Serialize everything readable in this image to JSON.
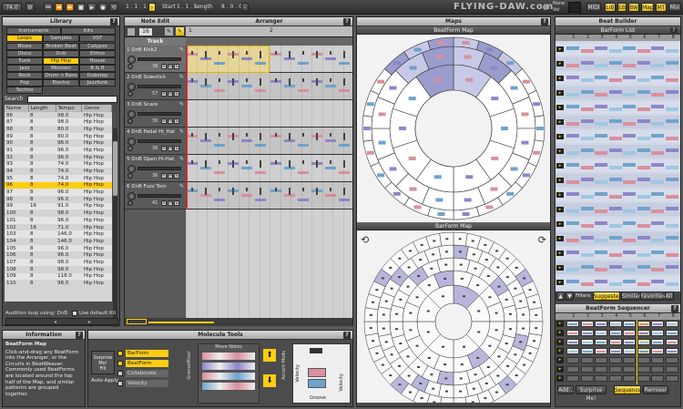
{
  "topbar": {
    "tempo": "74.0",
    "position1": "1 . 1 . 1",
    "start_label": "Start",
    "position2": "1 . 1 . 1",
    "length_label": "Length",
    "length_value": "8 . 0 . 0",
    "brand": "FLYING-DAW.com",
    "none_label": "None",
    "vol_label": "Vol",
    "view_buttons": [
      "MIDI",
      "LIB",
      "EB",
      "BW",
      "Map",
      "MT",
      "Mix"
    ]
  },
  "library": {
    "title": "Library",
    "categories_top": [
      "Instruments",
      "Kits"
    ],
    "categories_tabs": [
      "Loops",
      "Samples",
      "VST"
    ],
    "genres": [
      [
        "Blues",
        "Broken Beat",
        "Calypso"
      ],
      [
        "Disco",
        "Dub",
        "Ethno"
      ],
      [
        "Funk",
        "Hip Hop",
        "House"
      ],
      [
        "Jazz",
        "Motown",
        "R & B"
      ],
      [
        "Rock",
        "Drum n Bass",
        "Dubstep"
      ],
      [
        "Pop",
        "Electro",
        "Jazzfunk"
      ],
      [
        "Techno",
        "",
        ""
      ]
    ],
    "search_label": "Search",
    "columns": [
      "Name",
      "Length",
      "Tempo",
      "Genre"
    ],
    "rows": [
      [
        "86",
        "8",
        "98.0",
        "Hip Hop"
      ],
      [
        "87",
        "8",
        "98.0",
        "Hip Hop"
      ],
      [
        "88",
        "8",
        "80.0",
        "Hip Hop"
      ],
      [
        "89",
        "8",
        "80.0",
        "Hip Hop"
      ],
      [
        "90",
        "8",
        "96.0",
        "Hip Hop"
      ],
      [
        "91",
        "8",
        "96.0",
        "Hip Hop"
      ],
      [
        "92",
        "8",
        "96.0",
        "Hip Hop"
      ],
      [
        "93",
        "8",
        "74.0",
        "Hip Hop"
      ],
      [
        "94",
        "8",
        "74.0",
        "Hip Hop"
      ],
      [
        "95",
        "8",
        "74.0",
        "Hip Hop"
      ],
      [
        "96",
        "8",
        "74.0",
        "Hip Hop"
      ],
      [
        "97",
        "8",
        "96.0",
        "Hip Hop"
      ],
      [
        "98",
        "8",
        "96.0",
        "Hip Hop"
      ],
      [
        "99",
        "16",
        "91.0",
        "Hip Hop"
      ],
      [
        "100",
        "8",
        "98.0",
        "Hip Hop"
      ],
      [
        "101",
        "8",
        "96.0",
        "Hip Hop"
      ],
      [
        "102",
        "16",
        "71.0",
        "Hip Hop"
      ],
      [
        "103",
        "8",
        "146.0",
        "Hip Hop"
      ],
      [
        "104",
        "8",
        "146.0",
        "Hip Hop"
      ],
      [
        "105",
        "8",
        "96.0",
        "Hip Hop"
      ],
      [
        "106",
        "8",
        "96.0",
        "Hip Hop"
      ],
      [
        "107",
        "8",
        "98.0",
        "Hip Hop"
      ],
      [
        "108",
        "8",
        "98.0",
        "Hip Hop"
      ],
      [
        "109",
        "8",
        "118.0",
        "Hip Hop"
      ],
      [
        "110",
        "8",
        "96.0",
        "Hip Hop"
      ]
    ],
    "footer_label": "Audition loop using: DnB",
    "use_default_kit": "Use default Kit"
  },
  "note_edit": {
    "title": "Note Edit",
    "value": "16",
    "track_header": "Track"
  },
  "arranger": {
    "title": "Arranger",
    "ruler": [
      "1",
      "2"
    ]
  },
  "tracks": [
    {
      "name": "1 DnB Kick2",
      "vol": "36"
    },
    {
      "name": "2 DnB Sidestick",
      "vol": "57"
    },
    {
      "name": "3 DnB Snare",
      "vol": "30"
    },
    {
      "name": "4 DnB Pedal Hi_Hat",
      "vol": "36"
    },
    {
      "name": "5 DnB Open Hi-Hat",
      "vol": "36"
    },
    {
      "name": "6 DnB Fuzz Tom",
      "vol": "41"
    }
  ],
  "maps": {
    "title": "Maps",
    "beatform_map": "BeatForm Map",
    "barform_map": "BarForm Map"
  },
  "information": {
    "title": "Information",
    "heading": "BeatForm Map",
    "body": "Click-and-drag any BeatForm into the Arranger, or the Circuits in BeatWeaver. Commonly used BeatForms are located around the top half of the Map, and similar patterns are grouped together."
  },
  "molecule": {
    "title": "Molecule Tools",
    "surprise": "Surprise Me!",
    "surprise2": "Fill",
    "auto_apply": "Auto-Apply",
    "options": [
      "BarForm",
      "BeatForm",
      "Collaborate",
      "Velocity"
    ],
    "groove_mixer": "GrooveMixer",
    "move_notes": "Move Notes",
    "accent_mods": "Accent Mods",
    "velocity": "Velocity",
    "groove": "Groove"
  },
  "beat_builder": {
    "title": "Beat Builder",
    "list_title": "BarForm List",
    "columns": [
      "1",
      "2",
      "3",
      "4",
      "5",
      "6",
      "7",
      "8"
    ],
    "filters": "Filters",
    "tabs": [
      "Suggested",
      "Similar",
      "Favorites",
      "All"
    ],
    "seq_title": "BeatForm Sequencer",
    "seq_cols": [
      "1",
      "2",
      "3",
      "4",
      "5",
      "6",
      "7",
      "8"
    ],
    "bottom_buttons": [
      "Add...",
      "Surprise Me!",
      "Sequencer",
      "Remixer"
    ]
  },
  "colors": {
    "accent": "#ffcc11",
    "blue": "#6fa3cc",
    "pink": "#d98f9e",
    "purple": "#8d86c9"
  }
}
